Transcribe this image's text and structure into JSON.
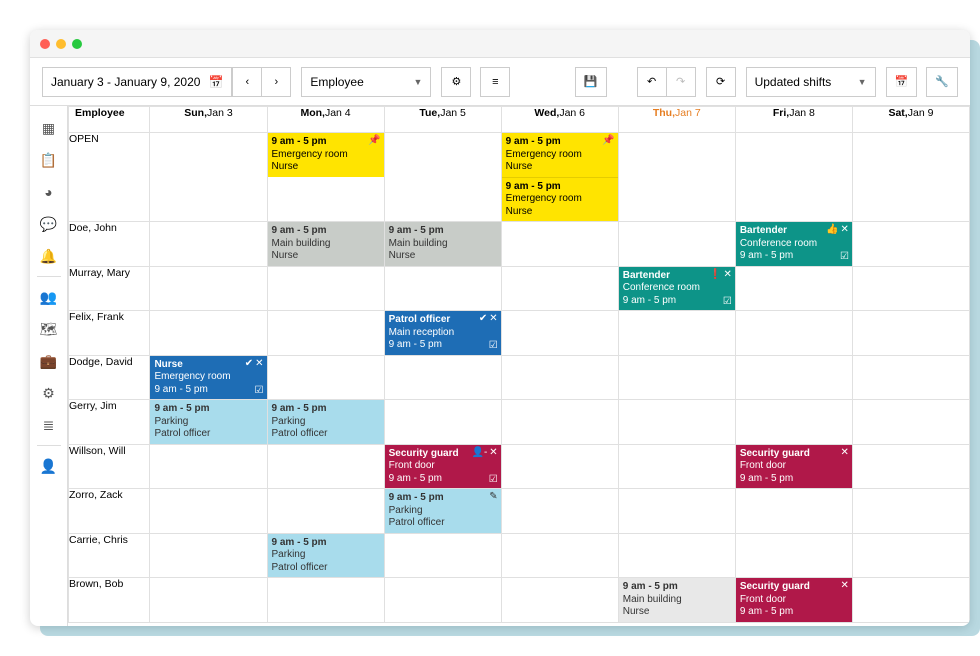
{
  "toolbar": {
    "date_range": "January 3 - January 9, 2020",
    "groupby": "Employee",
    "filter": "Updated shifts"
  },
  "headers": {
    "employee": "Employee",
    "days": [
      {
        "day": "Sun,",
        "date": "Jan 3",
        "today": false
      },
      {
        "day": "Mon,",
        "date": "Jan 4",
        "today": false
      },
      {
        "day": "Tue,",
        "date": "Jan 5",
        "today": false
      },
      {
        "day": "Wed,",
        "date": "Jan 6",
        "today": false
      },
      {
        "day": "Thu,",
        "date": "Jan 7",
        "today": true
      },
      {
        "day": "Fri,",
        "date": "Jan 8",
        "today": false
      },
      {
        "day": "Sat,",
        "date": "Jan 9",
        "today": false
      }
    ]
  },
  "employees": [
    "OPEN",
    "Doe, John",
    "Murray, Mary",
    "Felix, Frank",
    "Dodge, David",
    "Gerry, Jim",
    "Willson, Will",
    "Zorro, Zack",
    "Carrie, Chris",
    "Brown, Bob"
  ],
  "shifts": {
    "open_mon": {
      "time": "9 am - 5 pm",
      "loc": "Emergency room",
      "role": "Nurse"
    },
    "open_wed1": {
      "time": "9 am - 5 pm",
      "loc": "Emergency room",
      "role": "Nurse"
    },
    "open_wed2": {
      "time": "9 am - 5 pm",
      "loc": "Emergency room",
      "role": "Nurse"
    },
    "doe_mon": {
      "time": "9 am - 5 pm",
      "loc": "Main building",
      "role": "Nurse"
    },
    "doe_tue": {
      "time": "9 am - 5 pm",
      "loc": "Main building",
      "role": "Nurse"
    },
    "doe_fri": {
      "title": "Bartender",
      "loc": "Conference room",
      "time": "9 am - 5 pm"
    },
    "murray_thu": {
      "title": "Bartender",
      "loc": "Conference room",
      "time": "9 am - 5 pm"
    },
    "felix_tue": {
      "title": "Patrol officer",
      "loc": "Main reception",
      "time": "9 am - 5 pm"
    },
    "dodge_sun": {
      "title": "Nurse",
      "loc": "Emergency room",
      "time": "9 am - 5 pm"
    },
    "gerry_sun": {
      "time": "9 am - 5 pm",
      "loc": "Parking",
      "role": "Patrol officer"
    },
    "gerry_mon": {
      "time": "9 am - 5 pm",
      "loc": "Parking",
      "role": "Patrol officer"
    },
    "willson_tue": {
      "title": "Security guard",
      "loc": "Front door",
      "time": "9 am - 5 pm"
    },
    "willson_fri": {
      "title": "Security guard",
      "loc": "Front door",
      "time": "9 am - 5 pm"
    },
    "zorro_tue": {
      "time": "9 am - 5 pm",
      "loc": "Parking",
      "role": "Patrol officer"
    },
    "carrie_mon": {
      "time": "9 am - 5 pm",
      "loc": "Parking",
      "role": "Patrol officer"
    },
    "brown_thu": {
      "time": "9 am - 5 pm",
      "loc": "Main building",
      "role": "Nurse"
    },
    "brown_fri": {
      "title": "Security guard",
      "loc": "Front door",
      "time": "9 am - 5 pm"
    }
  }
}
